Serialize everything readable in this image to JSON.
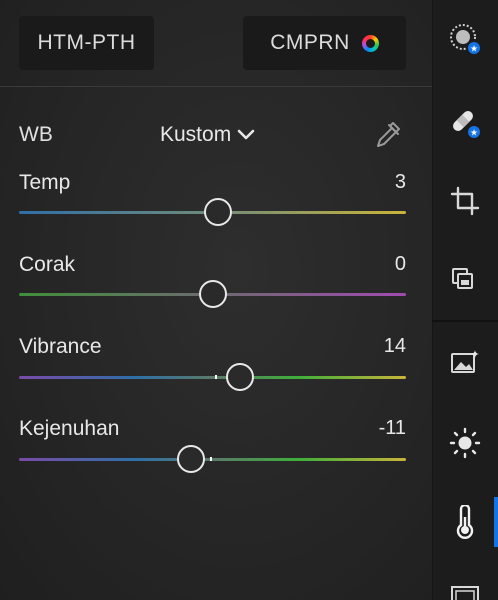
{
  "buttons": {
    "htm_pth": "HTM-PTH",
    "cmprn": "CMPRN"
  },
  "wb": {
    "label": "WB",
    "value": "Kustom"
  },
  "sliders": [
    {
      "label": "Temp",
      "value": "3",
      "position": 0.515
    },
    {
      "label": "Corak",
      "value": "0",
      "position": 0.5
    },
    {
      "label": "Vibrance",
      "value": "14",
      "position": 0.57
    },
    {
      "label": "Kejenuhan",
      "value": "-11",
      "position": 0.445
    }
  ],
  "rail": {
    "icons": [
      "presets-icon",
      "healing-icon",
      "crop-icon",
      "layers-icon",
      "ai-image-icon",
      "light-icon",
      "color-temperature-icon",
      "frame-icon"
    ],
    "active": "color-temperature-icon",
    "accent": "#1473e6"
  },
  "colors": {
    "temp_track": [
      "#2f6fa8",
      "#c9b43a"
    ],
    "corak_track": [
      "#3f8f3a",
      "#a04ab0"
    ],
    "sat_track": [
      "#7a4aa8",
      "#2f6fa8",
      "#3fae3a",
      "#c9b43a"
    ]
  }
}
